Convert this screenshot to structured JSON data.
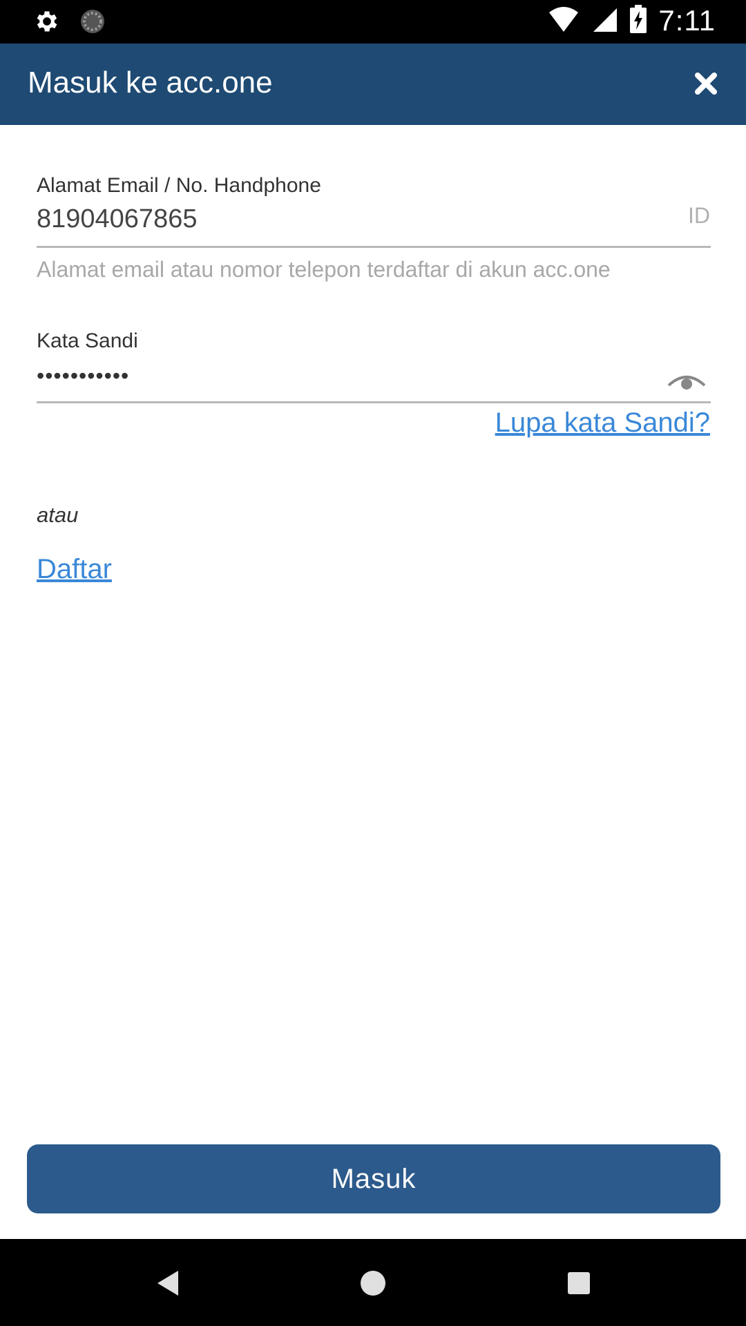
{
  "status_bar": {
    "time": "7:11",
    "icons": [
      "gear-icon",
      "sync-icon",
      "wifi-icon",
      "signal-icon",
      "battery-charging-icon"
    ]
  },
  "app_bar": {
    "title": "Masuk ke acc.one",
    "close_icon": "close-icon"
  },
  "form": {
    "email": {
      "label": "Alamat Email / No. Handphone",
      "value": "81904067865",
      "country_code": "ID",
      "helper": "Alamat email atau nomor telepon terdaftar di akun acc.one"
    },
    "password": {
      "label": "Kata Sandi",
      "value_masked": "•••••••••••",
      "toggle_icon": "eye-icon"
    },
    "forgot_link": "Lupa kata Sandi?",
    "or_text": "atau",
    "register_link": "Daftar"
  },
  "actions": {
    "login_button": "Masuk"
  },
  "nav_bar": {
    "icons": [
      "back-icon",
      "home-icon",
      "recents-icon"
    ]
  },
  "colors": {
    "app_bar": "#1e4a73",
    "button": "#2c5a8c",
    "link": "#3a88d8"
  }
}
